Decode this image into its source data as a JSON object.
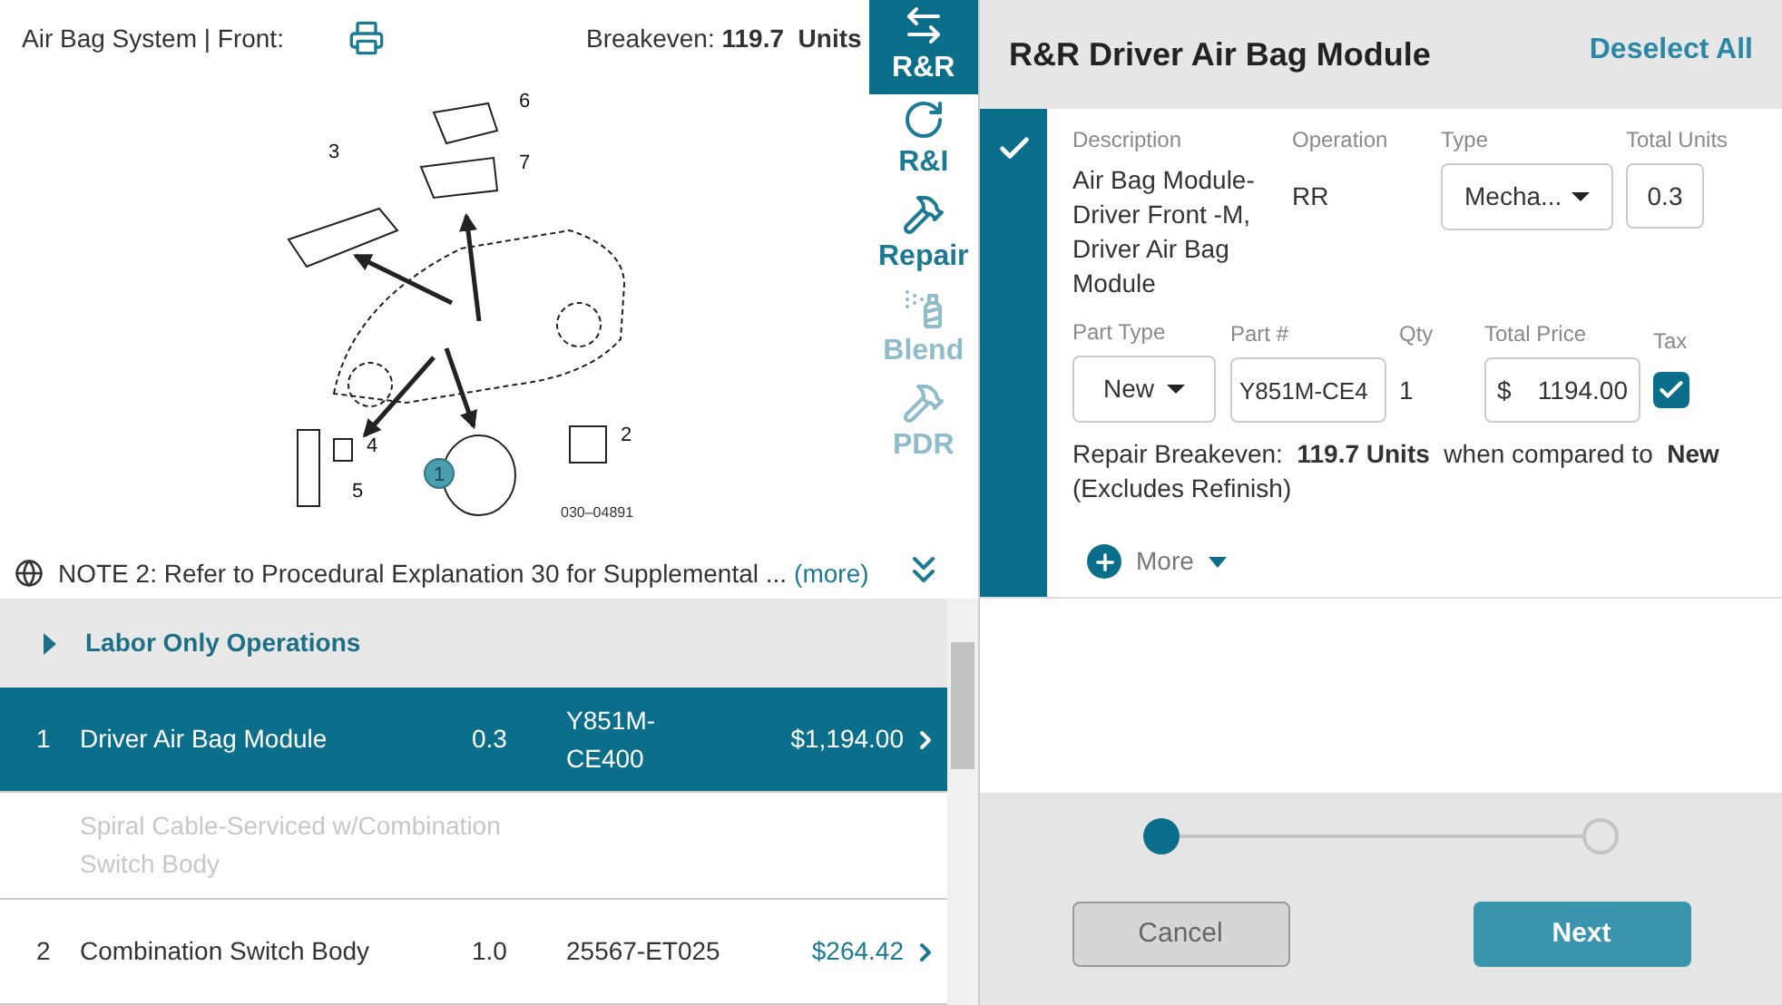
{
  "diagram_panel": {
    "title": "Air Bag System | Front:",
    "breakeven_label": "Breakeven:",
    "breakeven_value": "119.7  Units",
    "callouts": [
      {
        "label": "1",
        "highlighted": true
      },
      {
        "label": "2",
        "highlighted": false
      },
      {
        "label": "3",
        "highlighted": false
      },
      {
        "label": "4",
        "highlighted": false
      },
      {
        "label": "5",
        "highlighted": false
      },
      {
        "label": "6",
        "highlighted": false
      },
      {
        "label": "7",
        "highlighted": false
      }
    ],
    "figure_code": "030–04891",
    "note": "NOTE 2: Refer to Procedural Explanation 30 for Supplemental ...",
    "note_link": "(more)"
  },
  "operations": [
    {
      "kind": "rr",
      "label": "R&R",
      "selected": true,
      "disabled": false
    },
    {
      "kind": "ri",
      "label": "R&I",
      "selected": false,
      "disabled": false
    },
    {
      "kind": "repair",
      "label": "Repair",
      "selected": false,
      "disabled": false
    },
    {
      "kind": "blend",
      "label": "Blend",
      "selected": false,
      "disabled": true
    },
    {
      "kind": "pdr",
      "label": "PDR",
      "selected": false,
      "disabled": true
    }
  ],
  "parts_list": {
    "group": {
      "label": "Labor Only Operations",
      "expanded": false
    },
    "rows": [
      {
        "kind": "part",
        "number": "1",
        "name": "Driver Air Bag Module",
        "units": "0.3",
        "part_no": "Y851M-CE400",
        "price": "$1,194.00",
        "selected": true
      },
      {
        "kind": "note",
        "name": "Spiral Cable-Serviced w/Combination Switch Body"
      },
      {
        "kind": "part",
        "number": "2",
        "name": "Combination Switch Body",
        "units": "1.0",
        "part_no": "25567-ET025",
        "price": "$264.42",
        "selected": false
      }
    ]
  },
  "detail_panel": {
    "title": "R&R Driver Air Bag Module",
    "deselect_all": "Deselect All",
    "checked": true,
    "description_label": "Description",
    "description": "Air Bag Module-Driver Front -M, Driver Air Bag Module",
    "operation_label": "Operation",
    "operation": "RR",
    "type_label": "Type",
    "type": "Mecha...",
    "total_units_label": "Total Units",
    "total_units": "0.3",
    "part_type_label": "Part Type",
    "part_type": "New",
    "part_no_label": "Part #",
    "part_no": "Y851M-CE4",
    "qty_label": "Qty",
    "qty": "1",
    "total_price_label": "Total Price",
    "currency": "$",
    "total_price": "1194.00",
    "tax_label": "Tax",
    "tax": true,
    "breakeven": "Repair Breakeven:  **119.7 Units**  when compared to  **New**",
    "breakeven_note": "(Excludes Refinish)",
    "more": "More"
  },
  "stepper": {
    "steps": [
      {
        "done": true
      },
      {
        "done": false
      }
    ]
  },
  "buttons": {
    "cancel": "Cancel",
    "next": "Next"
  }
}
